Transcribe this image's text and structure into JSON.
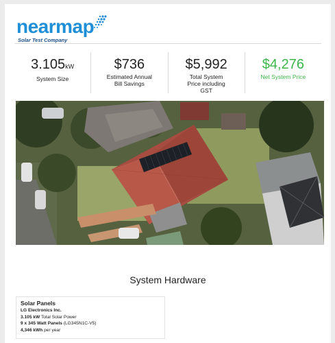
{
  "brand": {
    "logo_word": "nearmap",
    "tagline": "Solar Test Company",
    "colors": {
      "accent": "#1f8fd8",
      "dark": "#1c4f8a",
      "positive": "#3cb64a"
    }
  },
  "stats": [
    {
      "value": "3.105",
      "unit": "kW",
      "label": "System Size"
    },
    {
      "value": "$736",
      "label": "Estimated Annual Bill Savings"
    },
    {
      "value": "$5,992",
      "label": "Total System Price including GST"
    },
    {
      "value": "$4,276",
      "label": "Net System Price"
    }
  ],
  "hardware": {
    "title": "System Hardware",
    "panels_card": {
      "title": "Solar Panels",
      "manufacturer": "LG Electronics Inc.",
      "total_power_value": "3.105 kW",
      "total_power_label": "Total Solar Power",
      "panel_spec_value": "9 x 345 Watt Panels",
      "panel_model": "(LG345N1C-V5)",
      "yield_value": "4,346 kWh",
      "yield_label": "per year"
    }
  }
}
